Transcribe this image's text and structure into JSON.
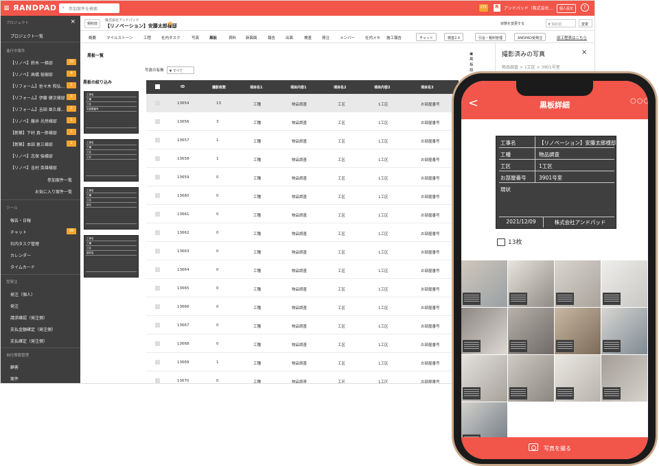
{
  "topbar": {
    "logo": "≡ ЯANDPAD",
    "search_placeholder": "参加案件を検索",
    "badge": "ZTE",
    "r_icon": "R",
    "company": "アンドパッド（株式会社…",
    "personal": "個人設定",
    "help": "?"
  },
  "sidebar": {
    "project_header": "プロジェクト",
    "close": "×",
    "project_list": "プロジェクト一覧",
    "in_progress_header": "進行中案件",
    "projects": [
      {
        "label": "【リノベ】鈴木 一條邸",
        "count": "20"
      },
      {
        "label": "【リノベ】高橋 裕樹邸",
        "count": "4"
      },
      {
        "label": "【リフォーム】佐々木 和弘…",
        "count": "3"
      },
      {
        "label": "【リフォーム】伊藤 健次様邸",
        "count": "3"
      },
      {
        "label": "【リフォーム】吉田 亜久様…",
        "count": "2"
      },
      {
        "label": "【リノベ】藤井 光然様邸",
        "count": "1"
      },
      {
        "label": "【新築】下村 真一郎様邸",
        "count": "1"
      },
      {
        "label": "【新築】本田 恵三様邸",
        "count": "1"
      },
      {
        "label": "【リノベ】志保 強様邸",
        "count": ""
      },
      {
        "label": "【リノベ】吉村 英雄様邸",
        "count": ""
      }
    ],
    "participating": "参加案件一覧",
    "favorites": "お気に入り案件一覧",
    "tools_header": "ツール",
    "tools": [
      {
        "label": "報告・日報",
        "count": ""
      },
      {
        "label": "チャット",
        "count": "99"
      },
      {
        "label": "社内タスク管理",
        "count": ""
      },
      {
        "label": "カレンダー",
        "count": ""
      },
      {
        "label": "タイムカード",
        "count": ""
      }
    ],
    "order_header": "受発注",
    "orders": [
      "発注（個人）",
      "発注",
      "請求確認（発注側）",
      "支払金額確定（発注側）",
      "支払確定（発注側）"
    ],
    "company_header": "自社情報管理",
    "company": [
      "顧客",
      "案件"
    ]
  },
  "project": {
    "contract_button": "契約前",
    "company_name": "株式会社アンドパッド",
    "project_name": "【リノベーション】安藤太郎様邸",
    "star": "★",
    "status_label": "状態を変更する",
    "status_select": "▼ 契約前",
    "change_button": "変更"
  },
  "tabs": [
    "概要",
    "マイルストーン",
    "工程",
    "社内タスク",
    "写真",
    "黒板",
    "資料",
    "新図面",
    "報告",
    "出面",
    "検査",
    "発注",
    "メンバー",
    "社内メモ",
    "施工報告"
  ],
  "tab_buttons": [
    "チャット",
    "検査2.0",
    "引合・粗利管理",
    "ANDPAD受発注"
  ],
  "external_link": "邸工程表はこちら",
  "list": {
    "title": "黒板一覧",
    "settings": "黒板設定"
  },
  "filter": {
    "title": "黒板の絞り込み",
    "photo_label": "写真の有無",
    "photo_select": "▼ すべて"
  },
  "boards": [
    [
      "工事名",
      "工種",
      "工区",
      "お部屋番号"
    ],
    [
      "工事名",
      "工種",
      "工区",
      "工区"
    ],
    [
      "工事名",
      "工種",
      "工区",
      "部位"
    ],
    [
      "工事名",
      "工種",
      "工区",
      "部材名"
    ]
  ],
  "table": {
    "headers": [
      "ID",
      "撮影枚数",
      "項目名1",
      "項目内容1",
      "項目名2",
      "項目内容2",
      "項目名3"
    ],
    "rows": [
      [
        "13654",
        "13",
        "工種",
        "物品調査",
        "工区",
        "1工区",
        "お部屋番号"
      ],
      [
        "13656",
        "3",
        "工種",
        "物品調査",
        "工区",
        "1工区",
        "お部屋番号"
      ],
      [
        "13657",
        "1",
        "工種",
        "物品調査",
        "工区",
        "1工区",
        "お部屋番号"
      ],
      [
        "13658",
        "1",
        "工種",
        "物品調査",
        "工区",
        "1工区",
        "お部屋番号"
      ],
      [
        "13659",
        "0",
        "工種",
        "物品調査",
        "工区",
        "1工区",
        "お部屋番号"
      ],
      [
        "13660",
        "0",
        "工種",
        "物品調査",
        "工区",
        "1工区",
        "お部屋番号"
      ],
      [
        "13661",
        "0",
        "工種",
        "物品調査",
        "工区",
        "1工区",
        "お部屋番号"
      ],
      [
        "13662",
        "0",
        "工種",
        "物品調査",
        "工区",
        "1工区",
        "お部屋番号"
      ],
      [
        "13663",
        "0",
        "工種",
        "物品調査",
        "工区",
        "1工区",
        "お部屋番号"
      ],
      [
        "13664",
        "0",
        "工種",
        "物品調査",
        "工区",
        "1工区",
        "お部屋番号"
      ],
      [
        "13665",
        "0",
        "工種",
        "物品調査",
        "工区",
        "1工区",
        "お部屋番号"
      ],
      [
        "13666",
        "0",
        "工種",
        "物品調査",
        "工区",
        "1工区",
        "お部屋番号"
      ],
      [
        "13667",
        "0",
        "工種",
        "物品調査",
        "工区",
        "1工区",
        "お部屋番号"
      ],
      [
        "13668",
        "0",
        "工種",
        "物品調査",
        "工区",
        "1工区",
        "お部屋番号"
      ],
      [
        "13669",
        "1",
        "工種",
        "物品調査",
        "工区",
        "1工区",
        "お部屋番号"
      ],
      [
        "13670",
        "0",
        "工種",
        "物品調査",
        "工区",
        "1工区",
        "お部屋番号"
      ]
    ]
  },
  "panel": {
    "title": "撮影済みの写真",
    "close": "×",
    "breadcrumb": "物品調査 > 1工区 > 3901号室"
  },
  "phone": {
    "back": "<",
    "title": "黒板詳細",
    "more": "○○○",
    "board": [
      {
        "label": "工事名",
        "value": "【リノベーション】安藤太郎様邸"
      },
      {
        "label": "工種",
        "value": "物品調査"
      },
      {
        "label": "工区",
        "value": "1工区"
      },
      {
        "label": "お部屋番号",
        "value": "3901号室"
      }
    ],
    "current_label": "現状",
    "date": "2021/12/09",
    "company": "株式会社アンドパッド",
    "photo_count": "13枚",
    "take_photo": "写真を撮る"
  },
  "colors": {
    "brand": "#f25549",
    "accent": "#f3a531",
    "sidebar": "#3e3e3e"
  }
}
